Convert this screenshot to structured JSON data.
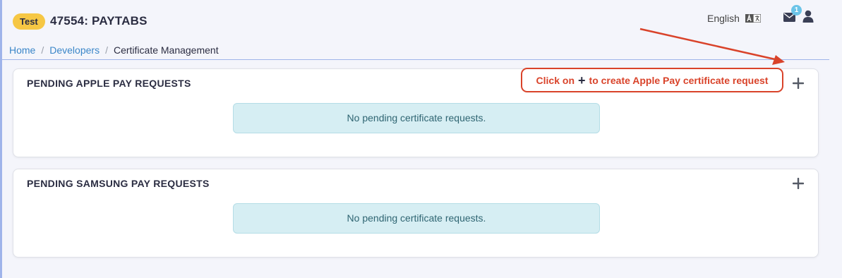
{
  "header": {
    "env_badge": "Test",
    "merchant_title": "47554: PAYTABS",
    "language": "English",
    "notification_count": "1"
  },
  "breadcrumb": {
    "home": "Home",
    "developers": "Developers",
    "current": "Certificate Management"
  },
  "sections": {
    "apple": {
      "title": "PENDING APPLE PAY REQUESTS",
      "empty_message": "No pending certificate requests."
    },
    "samsung": {
      "title": "PENDING SAMSUNG PAY REQUESTS",
      "empty_message": "No pending certificate requests."
    }
  },
  "annotation": {
    "prefix": "Click on",
    "symbol": "+",
    "suffix": "to create Apple Pay certificate request",
    "color": "#d9432a"
  },
  "colors": {
    "badge": "#f6c744",
    "link": "#3a86c8",
    "alert_bg": "#d6eef3",
    "alert_text": "#2f6572"
  },
  "icons": {
    "language": "language-translate-icon",
    "mail": "envelope-icon",
    "user": "user-icon",
    "add": "plus-icon",
    "arrow": "annotation-arrow"
  }
}
